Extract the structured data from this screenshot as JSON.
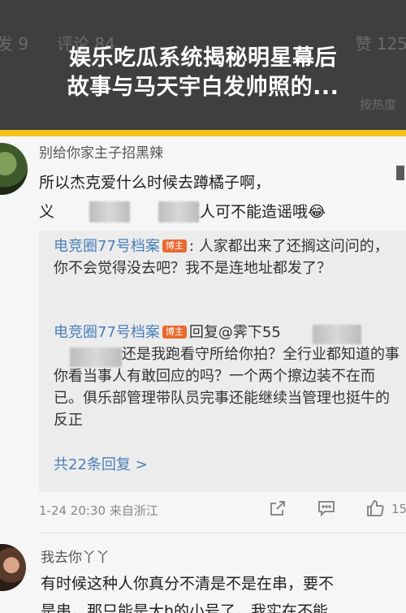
{
  "banner": {
    "title_line1": "娱乐吃瓜系统揭秘明星幕后",
    "title_line2": "故事与马天宇白发帅照的...",
    "bg_left": "发 9",
    "bg_mid": "评论 84",
    "bg_right": "赞 125",
    "bg_sub": "按热度"
  },
  "comment1": {
    "username": "别给你家主子招黑辣",
    "line1": "所以杰克爱什么时候去蹲橘子啊，",
    "line2_prefix": "义",
    "line2_suffix": "班人可不能造谣哦",
    "emoji": "😂"
  },
  "replies": [
    {
      "name": "电竞圈77号档案",
      "badge": "博主",
      "text": ": 人家都出来了还搁这问问的，你不会觉得没去吧？我不是连地址都发了？"
    },
    {
      "name": "电竞圈77号档案",
      "badge": "博主",
      "reply_to": "回复@霁下55",
      "text": "还是我跑看守所给你拍？全行业都知道的事你看当事人有敢回应的吗？一个两个擦边装不在而已。俱乐部管理带队员完事还能继续当管理也挺牛的反正"
    }
  ],
  "more_replies": "共22条回复 >",
  "meta": {
    "time": "1-24 20:30",
    "source": "来自浙江",
    "like_count": "15"
  },
  "icons": {
    "share": "share-icon",
    "comment": "comment-icon",
    "like": "thumbs-up-icon"
  },
  "comment2": {
    "username": "我去你丫丫",
    "line1": "有时候这种人你真分不清是不是在串，要不",
    "line2": "是串，那只能是大h的小号了，我实在不能"
  },
  "colors": {
    "banner_bg": "#3f3f3f",
    "accent_stripe": "#f5c11a",
    "link": "#4a7fb9",
    "badge": "#e8692f"
  }
}
